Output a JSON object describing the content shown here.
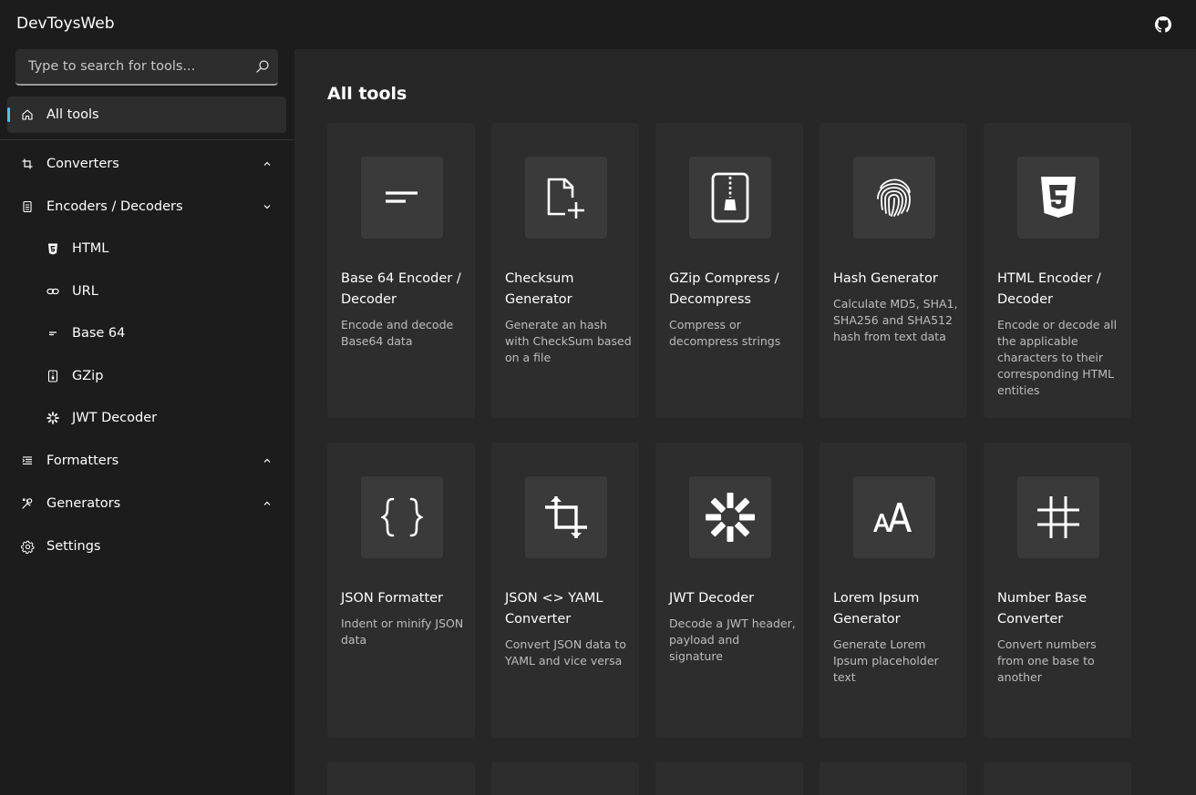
{
  "app": {
    "title": "DevToysWeb"
  },
  "search": {
    "placeholder": "Type to search for tools..."
  },
  "sidebar": {
    "items": [
      {
        "label": "All tools",
        "icon": "home-icon",
        "active": true
      },
      {
        "label": "Converters",
        "icon": "converters-icon",
        "chevron": "up"
      },
      {
        "label": "Encoders / Decoders",
        "icon": "encoders-icon",
        "chevron": "down",
        "children": [
          {
            "label": "HTML",
            "icon": "html5-icon"
          },
          {
            "label": "URL",
            "icon": "link-icon"
          },
          {
            "label": "Base 64",
            "icon": "base64-icon"
          },
          {
            "label": "GZip",
            "icon": "zip-icon"
          },
          {
            "label": "JWT Decoder",
            "icon": "jwt-icon"
          }
        ]
      },
      {
        "label": "Formatters",
        "icon": "formatters-icon",
        "chevron": "up"
      },
      {
        "label": "Generators",
        "icon": "generators-icon",
        "chevron": "up"
      },
      {
        "label": "Settings",
        "icon": "gear-icon"
      }
    ]
  },
  "main": {
    "heading": "All tools",
    "cards": [
      {
        "title": "Base 64 Encoder / Decoder",
        "desc": "Encode and decode Base64 data",
        "icon": "base64-icon"
      },
      {
        "title": "Checksum Generator",
        "desc": "Generate an hash with CheckSum based on a file",
        "icon": "file-add-icon"
      },
      {
        "title": "GZip Compress / Decompress",
        "desc": "Compress or decompress strings",
        "icon": "zip-icon"
      },
      {
        "title": "Hash Generator",
        "desc": "Calculate MD5, SHA1, SHA256 and SHA512 hash from text data",
        "icon": "fingerprint-icon"
      },
      {
        "title": "HTML Encoder / Decoder",
        "desc": "Encode or decode all the applicable characters to their corresponding HTML entities",
        "icon": "html5-icon"
      },
      {
        "title": "JSON Formatter",
        "desc": "Indent or minify JSON data",
        "icon": "braces-icon"
      },
      {
        "title": "JSON <> YAML Converter",
        "desc": "Convert JSON data to YAML and vice versa",
        "icon": "crop-icon"
      },
      {
        "title": "JWT Decoder",
        "desc": "Decode a JWT header, payload and signature",
        "icon": "jwt-icon"
      },
      {
        "title": "Lorem Ipsum Generator",
        "desc": "Generate Lorem Ipsum placeholder text",
        "icon": "text-size-icon"
      },
      {
        "title": "Number Base Converter",
        "desc": "Convert numbers from one base to another",
        "icon": "hash-icon"
      }
    ]
  },
  "colors": {
    "accent": "#4cc2ff",
    "sidebar_bg": "#1c1c1c",
    "main_bg": "#272727",
    "card_bg": "#2d2d2d"
  }
}
